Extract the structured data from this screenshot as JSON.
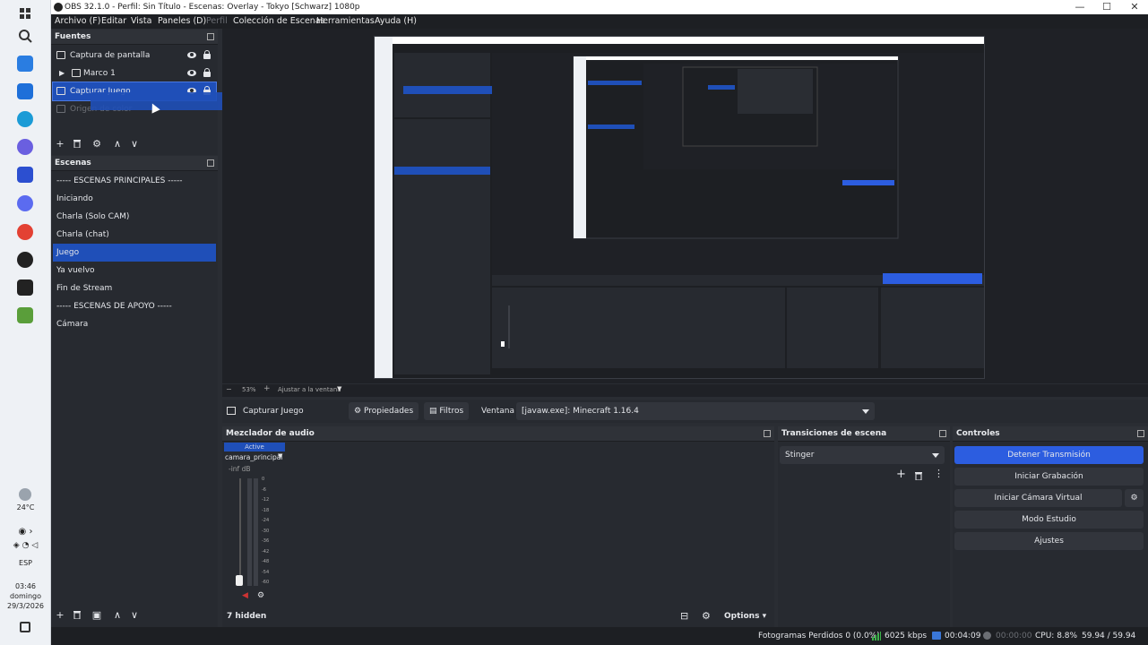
{
  "window": {
    "title": "OBS 32.1.0 - Perfil: Sin Título - Escenas: Overlay - Tokyo [Schwarz] 1080p",
    "minimize": "—",
    "maximize": "☐",
    "close": "✕"
  },
  "menu": [
    "Archivo (F)",
    "Editar",
    "Vista",
    "Paneles (D)",
    "Perfil",
    "Colección de Escenas",
    "Herramientas",
    "Ayuda (H)"
  ],
  "menu_disabled": [
    "Perfil"
  ],
  "taskbar": {
    "weather": "24°C",
    "lang": "ESP",
    "time": "03:46",
    "day": "domingo",
    "date": "29/3/2026"
  },
  "sources": {
    "title": "Fuentes",
    "items": [
      {
        "label": "Captura de pantalla",
        "icon": "monitor-icon",
        "selected": false
      },
      {
        "label": "Marco 1",
        "icon": "folder-icon",
        "selected": false
      },
      {
        "label": "Capturar Juego",
        "icon": "game-capture-icon",
        "selected": true
      },
      {
        "label": "Origen de color",
        "icon": "color-source-icon",
        "selected": false,
        "ghost": true
      }
    ],
    "toolbar": [
      "+",
      "🗑",
      "⚙",
      "∧",
      "∨"
    ]
  },
  "scenes": {
    "title": "Escenas",
    "items": [
      {
        "label": "----- ESCENAS PRINCIPALES -----",
        "selected": false
      },
      {
        "label": "Iniciando",
        "selected": false
      },
      {
        "label": "Charla (Solo CAM)",
        "selected": false
      },
      {
        "label": "Charla (chat)",
        "selected": false
      },
      {
        "label": "Juego",
        "selected": true
      },
      {
        "label": "Ya vuelvo",
        "selected": false
      },
      {
        "label": "Fin de Stream",
        "selected": false
      },
      {
        "label": "----- ESCENAS DE APOYO -----",
        "selected": false
      },
      {
        "label": "Cámara",
        "selected": false
      }
    ]
  },
  "preview": {
    "zoom": "53%",
    "zoom_mode": "Ajustar a la ventana"
  },
  "context": {
    "source_name": "Capturar Juego",
    "properties": "Propiedades",
    "filters": "Filtros",
    "window_label": "Ventana",
    "window_value": "[javaw.exe]: Minecraft 1.16.4"
  },
  "mixer": {
    "title": "Mezclador de audio",
    "tab": "Active",
    "channel": "camara_principal",
    "db": "-inf dB",
    "ticks": [
      "0",
      "-6",
      "-12",
      "-18",
      "-24",
      "-30",
      "-36",
      "-42",
      "-48",
      "-54",
      "-60"
    ],
    "hidden": "7 hidden",
    "options": "Options"
  },
  "transitions": {
    "title": "Transiciones de escena",
    "selected": "Stinger"
  },
  "controls": {
    "title": "Controles",
    "buttons": [
      "Detener Transmisión",
      "Iniciar Grabación",
      "Iniciar Cámara Virtual",
      "Modo Estudio",
      "Ajustes"
    ]
  },
  "status": {
    "dropped": "Fotogramas Perdidos 0 (0.0%)",
    "bitrate": "6025 kbps",
    "stream_time": "00:04:09",
    "rec_time": "00:00:00",
    "cpu": "CPU: 8.8%",
    "fps": "59.94 / 59.94 FPS"
  },
  "colors": {
    "accent": "#1f4fb8",
    "primary_button": "#2c5de0",
    "panel": "#272a30",
    "bitrate_ok": "#3cb34a"
  }
}
